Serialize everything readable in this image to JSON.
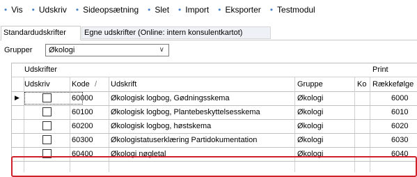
{
  "menu": [
    {
      "label": "Vis"
    },
    {
      "label": "Udskriv"
    },
    {
      "label": "Sideopsætning"
    },
    {
      "label": "Slet"
    },
    {
      "label": "Import"
    },
    {
      "label": "Eksporter"
    },
    {
      "label": "Testmodul"
    }
  ],
  "tabs": {
    "active": "Standardudskrifter",
    "inactive": "Egne udskrifter  (Online: intern konsulentkartot)"
  },
  "group": {
    "label": "Grupper",
    "value": "Økologi"
  },
  "grid": {
    "group_header_left": "Udskrifter",
    "group_header_right": "Print",
    "columns": [
      "Udskriv",
      "Kode",
      "Udskrift",
      "Gruppe",
      "Ko",
      "Rækkefølge"
    ],
    "sort_indicator": "/",
    "rows": [
      {
        "kode": "60000",
        "udskrift": "Økologisk logbog, Gødningsskema",
        "gruppe": "Økologi",
        "order": "6000"
      },
      {
        "kode": "60100",
        "udskrift": "Økologisk logbog, Plantebeskyttelsesskema",
        "gruppe": "Økologi",
        "order": "6010"
      },
      {
        "kode": "60200",
        "udskrift": "Økologisk logbog, høstskema",
        "gruppe": "Økologi",
        "order": "6020"
      },
      {
        "kode": "60300",
        "udskrift": "Økologistatuserklæring Partidokumentation",
        "gruppe": "Økologi",
        "order": "6030"
      },
      {
        "kode": "60400",
        "udskrift": "Økologi nøgletal",
        "gruppe": "Økologi",
        "order": "6040"
      }
    ]
  },
  "colors": {
    "highlight": "#d0202a",
    "menu_bullet": "#4f87c6"
  }
}
